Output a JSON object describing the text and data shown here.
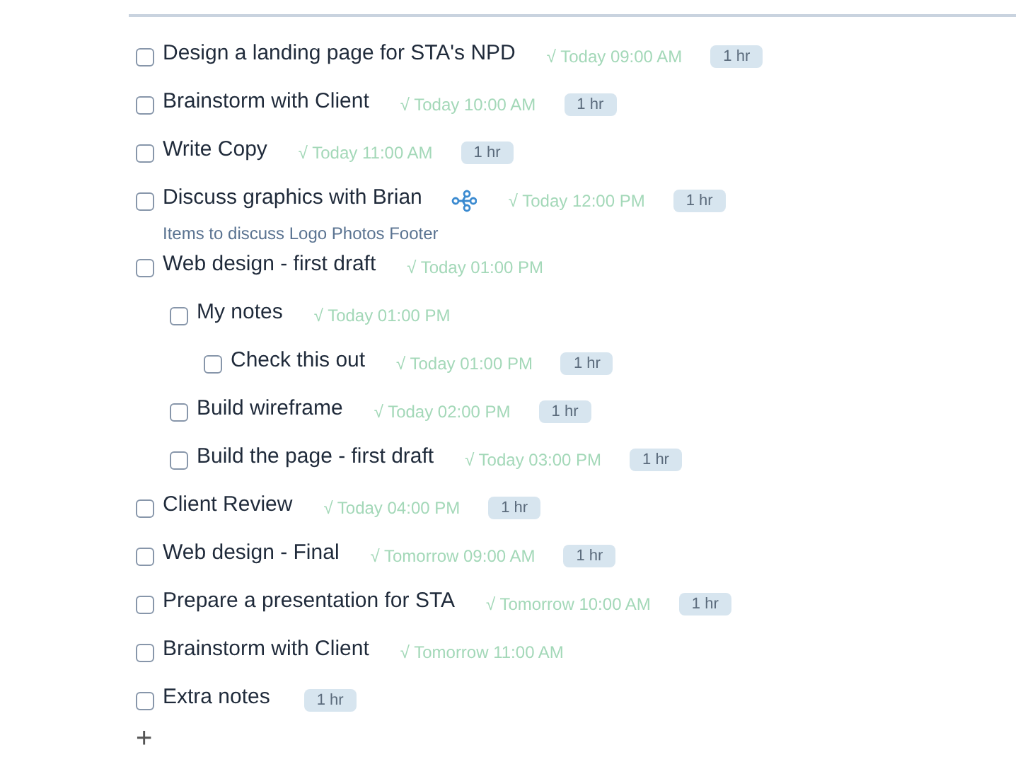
{
  "tasks": [
    {
      "title": "Design a landing page for STA's NPD",
      "checked": false,
      "due": "√ Today 09:00 AM",
      "duration": "1 hr"
    },
    {
      "title": "Brainstorm with Client",
      "checked": false,
      "due": "√ Today 10:00 AM",
      "duration": "1 hr"
    },
    {
      "title": "Write Copy",
      "checked": false,
      "due": "√ Today 11:00 AM",
      "duration": "1 hr"
    },
    {
      "title": "Discuss graphics with Brian",
      "checked": false,
      "mindmap": true,
      "due": "√ Today 12:00 PM",
      "duration": "1 hr",
      "note": "Items to discuss Logo Photos Footer"
    },
    {
      "title": "Web design - first draft",
      "checked": false,
      "due": "√ Today 01:00 PM",
      "children": [
        {
          "title": "My notes",
          "checked": false,
          "due": "√ Today 01:00 PM",
          "children": [
            {
              "title": "Check this out",
              "checked": false,
              "due": "√ Today 01:00 PM",
              "duration": "1 hr"
            }
          ]
        },
        {
          "title": "Build wireframe",
          "checked": false,
          "due": "√ Today 02:00 PM",
          "duration": "1 hr"
        },
        {
          "title": "Build the page - first draft",
          "checked": false,
          "due": "√ Today 03:00 PM",
          "duration": "1 hr"
        }
      ]
    },
    {
      "title": "Client Review",
      "checked": false,
      "due": "√ Today 04:00 PM",
      "duration": "1 hr"
    },
    {
      "title": "Web design - Final",
      "checked": false,
      "due": "√ Tomorrow 09:00 AM",
      "duration": "1 hr"
    },
    {
      "title": "Prepare a presentation for STA",
      "checked": false,
      "due": "√ Tomorrow 10:00 AM",
      "duration": "1 hr"
    },
    {
      "title": "Brainstorm with Client",
      "checked": false,
      "due": "√ Tomorrow 11:00 AM"
    },
    {
      "title": "Extra notes",
      "checked": false,
      "duration": "1 hr"
    }
  ],
  "add_button": "+"
}
